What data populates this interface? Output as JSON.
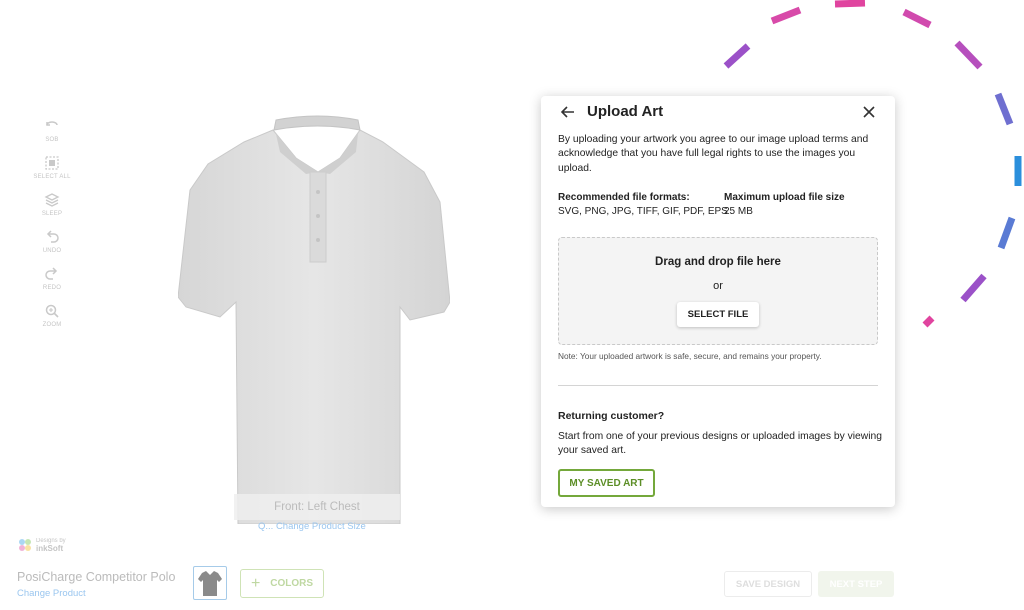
{
  "toolbar": {
    "tools": [
      {
        "label": "SOB",
        "icon": "rotate-icon"
      },
      {
        "label": "SELECT ALL",
        "icon": "select-all-icon"
      },
      {
        "label": "SLEEP",
        "icon": "layers-icon"
      },
      {
        "label": "UNDO",
        "icon": "undo-icon"
      },
      {
        "label": "REDO",
        "icon": "redo-icon"
      },
      {
        "label": "ZOOM",
        "icon": "zoom-icon"
      }
    ]
  },
  "canvas": {
    "view_label": "Front: Left Chest",
    "change_size_link": "Q... Change Product Size"
  },
  "brand": {
    "line1": "Designs by",
    "line2": "inkSoft"
  },
  "footer": {
    "product_name": "PosiCharge Competitor Polo",
    "change_product": "Change Product",
    "colors_label": "COLORS",
    "colors_icon": "plus-icon",
    "save_design_label": "SAVE DESIGN",
    "next_step_label": "NEXT STEP"
  },
  "modal": {
    "title": "Upload Art",
    "back_icon": "back-arrow-icon",
    "close_icon": "close-icon",
    "intro": "By uploading your artwork you agree to our image upload terms and acknowledge that you have full legal rights to use the images you upload.",
    "formats_heading": "Recommended file formats:",
    "formats_value": "SVG, PNG, JPG, TIFF, GIF, PDF, EPS",
    "size_heading": "Maximum upload file size",
    "size_value": "25 MB",
    "drop_text": "Drag and drop file here",
    "drop_or": "or",
    "select_file_label": "SELECT FILE",
    "note": "Note: Your uploaded artwork is safe, secure, and remains your property.",
    "returning_heading": "Returning customer?",
    "returning_desc": "Start from one of your previous designs or uploaded images by viewing your saved art.",
    "saved_art_label": "MY SAVED ART"
  },
  "colors": {
    "accent_green": "#74a83b",
    "link_blue": "#9ac6ef",
    "deco_pink": "#e0449f",
    "deco_purple": "#9b51c8",
    "deco_blue": "#4a7fd6"
  }
}
